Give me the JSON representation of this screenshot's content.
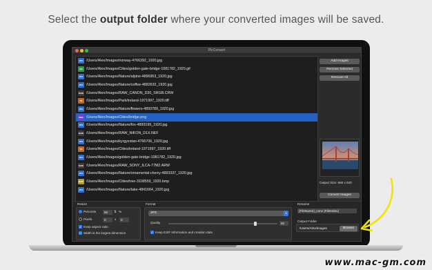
{
  "headline": {
    "prefix": "Select the ",
    "bold": "output folder",
    "suffix": " where your converted images will be saved."
  },
  "app": {
    "title": "PicConvert"
  },
  "files": [
    {
      "fmt": "JPG",
      "color": "#2f6fd6",
      "path": "/Users/Alex/Images/norway-4766392_1920.jpg"
    },
    {
      "fmt": "GIF",
      "color": "#2f9a4a",
      "path": "/Users/Alex/Images/Cities/golden-gate-bridge-1081782_1920.gif"
    },
    {
      "fmt": "JPG",
      "color": "#2f6fd6",
      "path": "/Users/Alex/Images/Nature/alpine-4896953_1920.jpg"
    },
    {
      "fmt": "JPG",
      "color": "#2f6fd6",
      "path": "/Users/Alex/Images/Nature/coffee-4882632_1920.jpg"
    },
    {
      "fmt": "RAW",
      "color": "#3c3c3c",
      "path": "/Users/Alex/Images/RAW_CANON_D30_SRGB.CRW"
    },
    {
      "fmt": "TIF",
      "color": "#c46a1e",
      "path": "/Users/Alex/Images/Park/ireland-1971997_1920.tiff"
    },
    {
      "fmt": "JPG",
      "color": "#2f6fd6",
      "path": "/Users/Alex/Images/Nature/flowers-4893789_1920.jpg"
    },
    {
      "fmt": "PNG",
      "color": "#7a3fd0",
      "path": "/Users/Alex/Images/Cities/bridge.png"
    },
    {
      "fmt": "JPG",
      "color": "#2f6fd6",
      "path": "/Users/Alex/Images/Nature/fox-4893199_1920.jpg"
    },
    {
      "fmt": "RAW",
      "color": "#3c3c3c",
      "path": "/Users/Alex/Images/RAW_NIKON_D1X.NEF"
    },
    {
      "fmt": "JPG",
      "color": "#2f6fd6",
      "path": "/Users/Alex/Images/kyrgyzstan-4766706_1920.jpg"
    },
    {
      "fmt": "TIF",
      "color": "#c46a1e",
      "path": "/Users/Alex/Images/Cities/ireland-1971997_1920.tiff"
    },
    {
      "fmt": "JPG",
      "color": "#2f6fd6",
      "path": "/Users/Alex/Images/golden-gate-bridge-1081782_1920.jpg"
    },
    {
      "fmt": "RAW",
      "color": "#3c3c3c",
      "path": "/Users/Alex/Images/RAW_SONY_ILCA-77M2.ARW"
    },
    {
      "fmt": "JPG",
      "color": "#2f6fd6",
      "path": "/Users/Alex/Images/Nature/ornamental-cherry-4893337_1920.jpg"
    },
    {
      "fmt": "BMP",
      "color": "#b59a2c",
      "path": "/Users/Alex/Images/Cities/tree-3108559_1920.bmp"
    },
    {
      "fmt": "JPG",
      "color": "#2f6fd6",
      "path": "/Users/Alex/Images/Nature/lake-4841664_1920.jpg"
    }
  ],
  "selected_index": 7,
  "side": {
    "add": "Add Images",
    "remove_selected": "Remove Selected",
    "remove_all": "Remove All",
    "output_size": "Output Size: 960 x 640",
    "convert": "Convert Images"
  },
  "resize": {
    "title": "Resize",
    "percents": "Percents",
    "percent_value": "50",
    "percent_unit": "%",
    "pixels": "Pixels",
    "px_w": "0",
    "px_x": "x",
    "px_h": "0",
    "keep_aspect": "Keep aspect ratio",
    "width_largest": "Width is the largest dimension"
  },
  "format": {
    "title": "Format",
    "selected": "JPG",
    "quality_label": "Quality",
    "quality_value": "80",
    "quality_fraction": 0.8,
    "keep_exif": "Keep EXIF information and creation date"
  },
  "rename": {
    "title": "Rename",
    "pattern": "{FileName}_conv {FileIndex}"
  },
  "output": {
    "title": "Output Folder",
    "path": "/Users/Alex/Images",
    "browse": "Browse"
  },
  "watermark": "www.mac-gm.com",
  "accent": "#2361c5"
}
